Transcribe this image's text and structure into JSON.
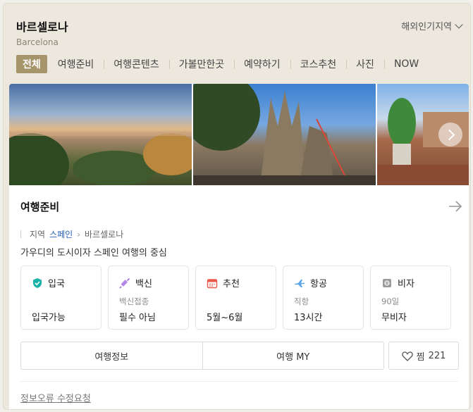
{
  "header": {
    "title": "바르셀로나",
    "subtitle": "Barcelona",
    "region_menu": "해외인기지역"
  },
  "tabs": [
    "전체",
    "여행준비",
    "여행콘텐츠",
    "가볼만한곳",
    "예약하기",
    "코스추천",
    "사진",
    "NOW"
  ],
  "active_tab": "전체",
  "section": {
    "title": "여행준비",
    "breadcrumb": [
      "지역",
      "스페인",
      "바르셀로나"
    ],
    "description": "가우디의 도시이자 스페인 여행의 중심"
  },
  "info_cards": [
    {
      "label": "입국",
      "sub": "",
      "value": "입국가능",
      "icon": "shield-check-icon",
      "color": "#19b3a8"
    },
    {
      "label": "백신",
      "sub": "백신접종",
      "value": "필수 아님",
      "icon": "syringe-icon",
      "color": "#9b6fd6"
    },
    {
      "label": "추천",
      "sub": "",
      "value": "5월~6월",
      "icon": "calendar-icon",
      "color": "#e8594a"
    },
    {
      "label": "항공",
      "sub": "직항",
      "value": "13시간",
      "icon": "airplane-icon",
      "color": "#5aa6e8"
    },
    {
      "label": "비자",
      "sub": "90일",
      "value": "무비자",
      "icon": "passport-icon",
      "color": "#8c8c8c"
    }
  ],
  "actions": {
    "travel_info": "여행정보",
    "travel_my": "여행 MY",
    "like_label": "찜",
    "like_count": "221"
  },
  "report_link": "정보오류 수정요청"
}
